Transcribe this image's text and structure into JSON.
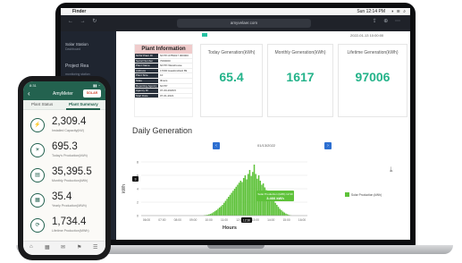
{
  "laptop": {
    "menubar": {
      "app": "Finder",
      "clock": "Sun 12:14 PM",
      "icons": "◑ ≋ ⌕"
    },
    "browser": {
      "address": "amyvelaer.com",
      "nav": "← → ↻",
      "tools": "⇪ ⊕ ⋯"
    },
    "sidebar": {
      "title": "Solar Station",
      "subtitle": "Dashboard",
      "section": "Project Rea",
      "item": "monitoring station"
    },
    "top_date": "2022-01-13 10:00:00",
    "plant_info": {
      "title": "Plant Information",
      "rows": [
        {
          "k": "NOW Plant ID",
          "v": "NOTP-0789017 000000"
        },
        {
          "k": "Serial Number",
          "v": "7000000"
        },
        {
          "k": "Plant Name",
          "v": "NOTP-Warehouse"
        },
        {
          "k": "Address",
          "v": "17000 Hawkinsfield 89"
        },
        {
          "k": "Plant Size",
          "v": "10"
        },
        {
          "k": "State",
          "v": "Illinois"
        },
        {
          "k": "Reporting Agency",
          "v": "NOTP"
        },
        {
          "k": "Agency ID",
          "v": "07-00-2020/3"
        },
        {
          "k": "Start Date",
          "v": "07-01-2021"
        }
      ]
    },
    "cards": [
      {
        "label": "Today Generation(kWh)",
        "value": "65.4"
      },
      {
        "label": "Monthly Generation(kWh)",
        "value": "1617"
      },
      {
        "label": "Lifetime Generation(kWh)",
        "value": "97006"
      }
    ],
    "daily": {
      "title": "Daily Generation",
      "date": "01/13/2022",
      "prev": "‹",
      "next": "›",
      "download": "⤓"
    }
  },
  "chart_data": {
    "type": "bar",
    "title": "",
    "xlabel": "Hours",
    "ylabel": "kWh",
    "ylim": [
      0,
      8
    ],
    "x_ticks": [
      "06:00",
      "07:00",
      "08:00",
      "09:00",
      "10:00",
      "11:00",
      "12:00",
      "13:00",
      "14:00",
      "15:00",
      "16:00"
    ],
    "y_ticks": [
      "0",
      "2",
      "4",
      "6",
      "8"
    ],
    "grid": true,
    "legend_position": "right",
    "series": [
      {
        "name": "Solar Production (kWh)",
        "color": "#5ec23a",
        "values": [
          0.05,
          0.08,
          0.12,
          0.18,
          0.25,
          0.35,
          0.5,
          0.65,
          0.8,
          1.0,
          1.2,
          1.4,
          1.6,
          1.9,
          2.2,
          2.5,
          2.8,
          3.1,
          3.4,
          3.7,
          4.0,
          4.3,
          4.6,
          4.9,
          5.2,
          5.0,
          5.6,
          6.0,
          5.4,
          6.2,
          6.8,
          5.9,
          6.5,
          7.6,
          6.2,
          5.5,
          6.0,
          5.2,
          4.6,
          4.8,
          4.2,
          3.8,
          3.5,
          3.2,
          2.8,
          2.5,
          2.2,
          1.9,
          1.6,
          1.3,
          1.0,
          0.8,
          0.6,
          0.45,
          0.3,
          0.2,
          0.1,
          0.05
        ]
      }
    ],
    "tooltip": {
      "line1": "Solar Production (kWh) 12:30",
      "line2": "3.466 kWh"
    },
    "highlight": {
      "x_label": "12:30",
      "y_label": "3"
    }
  },
  "phone": {
    "status": {
      "time": "8:31",
      "right": "▮▮ ◔"
    },
    "back": "‹",
    "app_name": "AmyMeter",
    "logo": "SOLAR",
    "tabs": [
      "Plant Status",
      "Plant Summary"
    ],
    "items": [
      {
        "icon": "⚡",
        "value": "2,309.4",
        "label": "Installed Capacity(kW)"
      },
      {
        "icon": "☀",
        "value": "695.3",
        "label": "Today's Production(kWh)"
      },
      {
        "icon": "▤",
        "value": "35,395.5",
        "label": "Monthly Production(kWh)"
      },
      {
        "icon": "▦",
        "value": "35.4",
        "label": "Yearly Production(MWh)"
      },
      {
        "icon": "⟳",
        "value": "1,734.4",
        "label": "Lifetime Production(MWh)"
      }
    ],
    "nav": [
      "⌂",
      "▦",
      "✉",
      "⚑",
      "☰"
    ]
  }
}
